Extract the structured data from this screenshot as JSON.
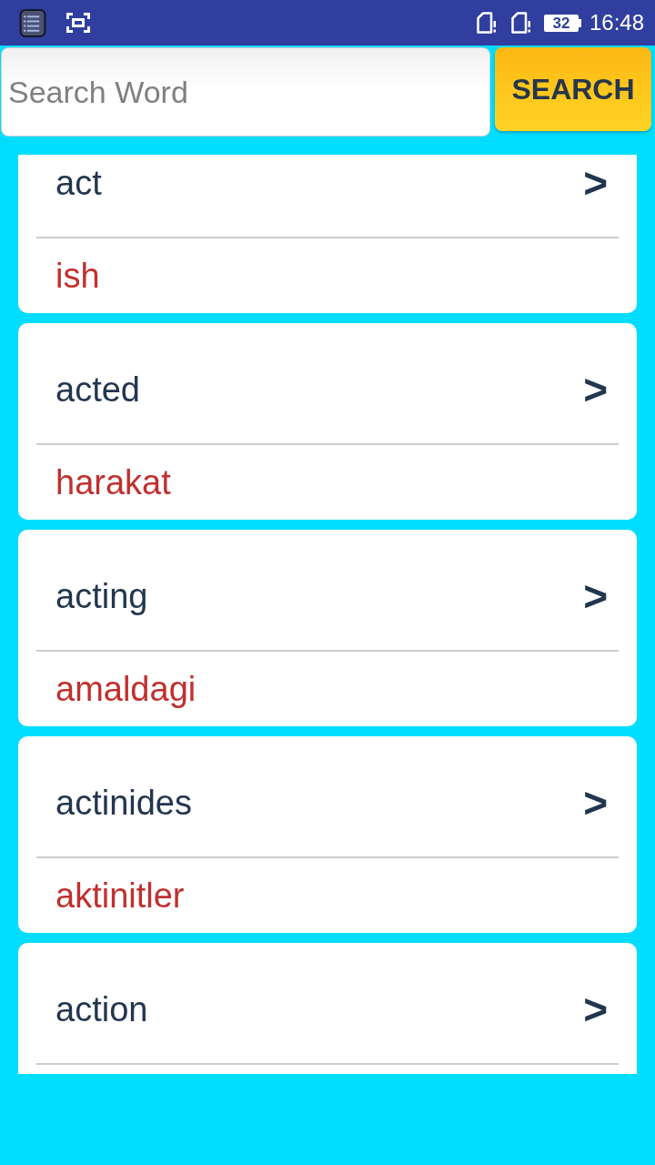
{
  "status_bar": {
    "battery": "32",
    "time": "16:48"
  },
  "search": {
    "placeholder": "Search Word",
    "button": "SEARCH"
  },
  "results": [
    {
      "word": "act",
      "arrow": ">",
      "translation": "ish"
    },
    {
      "word": "acted",
      "arrow": ">",
      "translation": "harakat"
    },
    {
      "word": "acting",
      "arrow": ">",
      "translation": "amaldagi"
    },
    {
      "word": "actinides",
      "arrow": ">",
      "translation": "aktinitler"
    },
    {
      "word": "action",
      "arrow": ">"
    }
  ]
}
